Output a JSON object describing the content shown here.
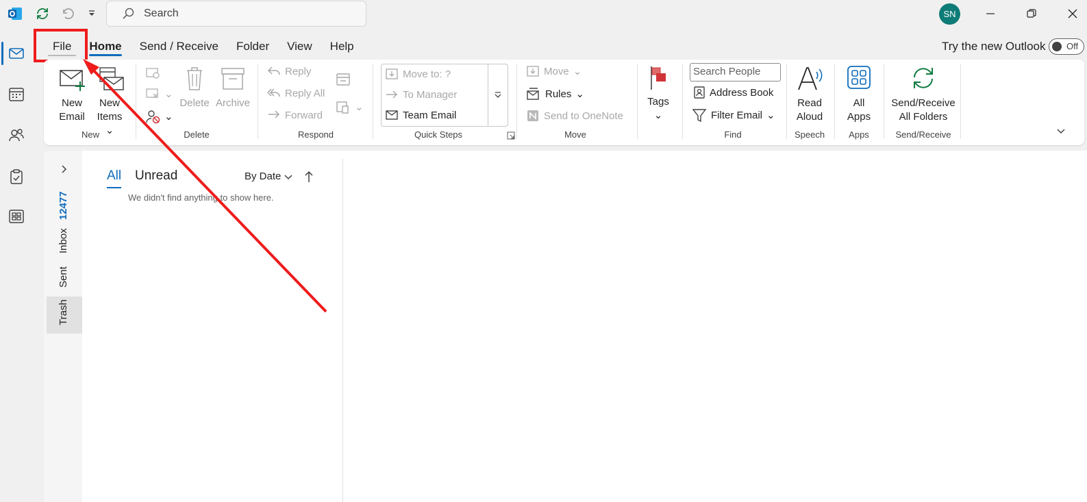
{
  "titlebar": {
    "search_placeholder": "Search",
    "avatar_initials": "SN"
  },
  "tabs": [
    "File",
    "Home",
    "Send / Receive",
    "Folder",
    "View",
    "Help"
  ],
  "try_new": {
    "label": "Try the new Outlook",
    "toggle": "Off"
  },
  "ribbon": {
    "new": {
      "label": "New",
      "new_email": [
        "New",
        "Email"
      ],
      "new_items": [
        "New",
        "Items"
      ]
    },
    "delete": {
      "label": "Delete",
      "delete": "Delete",
      "archive": "Archive"
    },
    "respond": {
      "label": "Respond",
      "reply": "Reply",
      "reply_all": "Reply All",
      "forward": "Forward"
    },
    "quick_steps": {
      "label": "Quick Steps",
      "move_to": "Move to: ?",
      "to_manager": "To Manager",
      "team_email": "Team Email"
    },
    "move": {
      "label": "Move",
      "move": "Move",
      "rules": "Rules",
      "onenote": "Send to OneNote"
    },
    "tags": {
      "label": "Tags"
    },
    "find": {
      "label": "Find",
      "search_people": "Search People",
      "address_book": "Address Book",
      "filter_email": "Filter Email"
    },
    "speech": {
      "label": "Speech",
      "read_aloud": [
        "Read",
        "Aloud"
      ]
    },
    "apps": {
      "label": "Apps",
      "all_apps": [
        "All",
        "Apps"
      ]
    },
    "send_receive": {
      "label": "Send/Receive",
      "all_folders": [
        "Send/Receive",
        "All Folders"
      ]
    }
  },
  "folders": {
    "inbox": "Inbox",
    "inbox_count": "12477",
    "sent": "Sent",
    "trash": "Trash"
  },
  "message_list": {
    "tab_all": "All",
    "tab_unread": "Unread",
    "sort": "By Date",
    "empty": "We didn't find anything to show here."
  },
  "colors": {
    "accent": "#0f6cbd",
    "annotation": "#ee1c1c"
  }
}
